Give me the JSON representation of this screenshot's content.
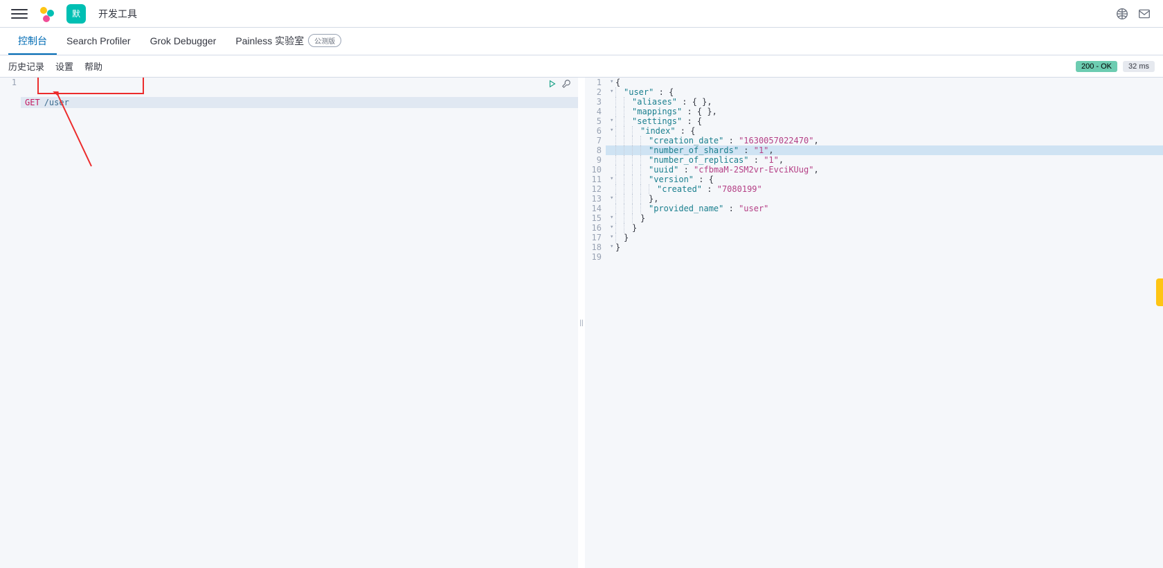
{
  "header": {
    "space_initial": "默",
    "breadcrumb": "开发工具"
  },
  "tabs": [
    {
      "label": "控制台",
      "active": true
    },
    {
      "label": "Search Profiler",
      "active": false
    },
    {
      "label": "Grok Debugger",
      "active": false
    },
    {
      "label": "Painless 实验室",
      "active": false,
      "beta": "公测版"
    }
  ],
  "menu": {
    "history": "历史记录",
    "settings": "设置",
    "help": "帮助"
  },
  "status": {
    "code": "200 - OK",
    "time": "32 ms"
  },
  "request": {
    "line_no": "1",
    "method": "GET",
    "path": "/user"
  },
  "response": {
    "lines": [
      {
        "n": "1",
        "fold": true,
        "tokens": [
          {
            "t": "punc",
            "v": "{"
          }
        ]
      },
      {
        "n": "2",
        "fold": true,
        "ind": 1,
        "tokens": [
          {
            "t": "key",
            "v": "\"user\""
          },
          {
            "t": "punc",
            "v": " : {"
          }
        ]
      },
      {
        "n": "3",
        "ind": 2,
        "tokens": [
          {
            "t": "key",
            "v": "\"aliases\""
          },
          {
            "t": "punc",
            "v": " : { },"
          }
        ]
      },
      {
        "n": "4",
        "ind": 2,
        "tokens": [
          {
            "t": "key",
            "v": "\"mappings\""
          },
          {
            "t": "punc",
            "v": " : { },"
          }
        ]
      },
      {
        "n": "5",
        "fold": true,
        "ind": 2,
        "tokens": [
          {
            "t": "key",
            "v": "\"settings\""
          },
          {
            "t": "punc",
            "v": " : {"
          }
        ]
      },
      {
        "n": "6",
        "fold": true,
        "ind": 3,
        "tokens": [
          {
            "t": "key",
            "v": "\"index\""
          },
          {
            "t": "punc",
            "v": " : {"
          }
        ]
      },
      {
        "n": "7",
        "ind": 4,
        "tokens": [
          {
            "t": "key",
            "v": "\"creation_date\""
          },
          {
            "t": "punc",
            "v": " : "
          },
          {
            "t": "str",
            "v": "\"1630057022470\""
          },
          {
            "t": "punc",
            "v": ","
          }
        ]
      },
      {
        "n": "8",
        "hl": true,
        "ind": 4,
        "tokens": [
          {
            "t": "key",
            "v": "\"number_of_shards\""
          },
          {
            "t": "punc",
            "v": " : "
          },
          {
            "t": "str",
            "v": "\"1\""
          },
          {
            "t": "punc",
            "v": ","
          }
        ]
      },
      {
        "n": "9",
        "ind": 4,
        "tokens": [
          {
            "t": "key",
            "v": "\"number_of_replicas\""
          },
          {
            "t": "punc",
            "v": " : "
          },
          {
            "t": "str",
            "v": "\"1\""
          },
          {
            "t": "punc",
            "v": ","
          }
        ]
      },
      {
        "n": "10",
        "ind": 4,
        "tokens": [
          {
            "t": "key",
            "v": "\"uuid\""
          },
          {
            "t": "punc",
            "v": " : "
          },
          {
            "t": "str",
            "v": "\"cfbmaM-2SM2vr-EvciKUug\""
          },
          {
            "t": "punc",
            "v": ","
          }
        ]
      },
      {
        "n": "11",
        "fold": true,
        "ind": 4,
        "tokens": [
          {
            "t": "key",
            "v": "\"version\""
          },
          {
            "t": "punc",
            "v": " : {"
          }
        ]
      },
      {
        "n": "12",
        "ind": 5,
        "tokens": [
          {
            "t": "key",
            "v": "\"created\""
          },
          {
            "t": "punc",
            "v": " : "
          },
          {
            "t": "str",
            "v": "\"7080199\""
          }
        ]
      },
      {
        "n": "13",
        "fold": true,
        "ind": 4,
        "tokens": [
          {
            "t": "punc",
            "v": "},"
          }
        ]
      },
      {
        "n": "14",
        "ind": 4,
        "tokens": [
          {
            "t": "key",
            "v": "\"provided_name\""
          },
          {
            "t": "punc",
            "v": " : "
          },
          {
            "t": "str",
            "v": "\"user\""
          }
        ]
      },
      {
        "n": "15",
        "fold": true,
        "ind": 3,
        "tokens": [
          {
            "t": "punc",
            "v": "}"
          }
        ]
      },
      {
        "n": "16",
        "fold": true,
        "ind": 2,
        "tokens": [
          {
            "t": "punc",
            "v": "}"
          }
        ]
      },
      {
        "n": "17",
        "fold": true,
        "ind": 1,
        "tokens": [
          {
            "t": "punc",
            "v": "}"
          }
        ]
      },
      {
        "n": "18",
        "fold": true,
        "tokens": [
          {
            "t": "punc",
            "v": "}"
          }
        ]
      },
      {
        "n": "19",
        "tokens": []
      }
    ]
  }
}
